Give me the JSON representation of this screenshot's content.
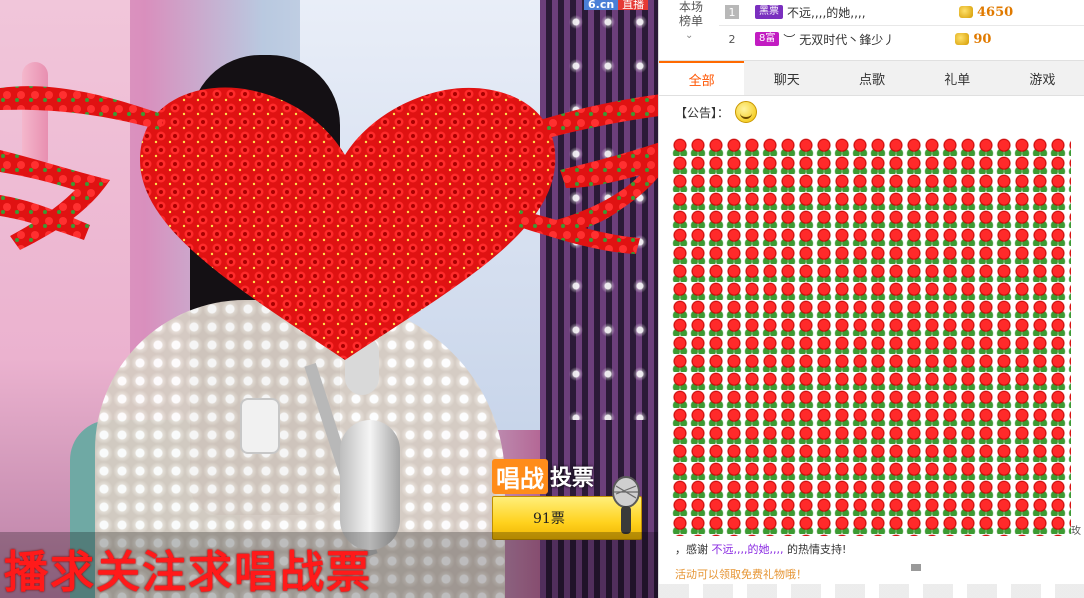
{
  "video": {
    "site_badge": "6.cn",
    "live_badge": "直播",
    "vote": {
      "title_highlight": "唱战",
      "title_rest": "投票",
      "count": "91票"
    },
    "caption": "播求关注求唱战票"
  },
  "ranking": {
    "label_line1": "本场",
    "label_line2": "榜单",
    "rows": [
      {
        "rank": "1",
        "badge": "黑票",
        "badge_color": "#7a2fbf",
        "name": "不远,,,,的她,,,,",
        "score": "4650"
      },
      {
        "rank": "2",
        "badge": "8富",
        "badge_color": "#c21cc2",
        "name": "︶ 无双时代丶鋒少丿",
        "score": "90"
      }
    ]
  },
  "tabs": [
    {
      "label": "全部",
      "active": true
    },
    {
      "label": "聊天",
      "active": false
    },
    {
      "label": "点歌",
      "active": false
    },
    {
      "label": "礼单",
      "active": false
    },
    {
      "label": "游戏",
      "active": false
    }
  ],
  "chat": {
    "notice_label": "【公告】：",
    "edge_label": "玫",
    "thanks_prefix": "，感谢",
    "thanks_name": "不远,,,,的她,,,,",
    "thanks_suffix": "的热情支持!",
    "activity_text": "活动可以领取免费礼物哦！"
  },
  "colors": {
    "accent": "#ff6a00",
    "rose": "#e01212",
    "score": "#e07a00"
  }
}
